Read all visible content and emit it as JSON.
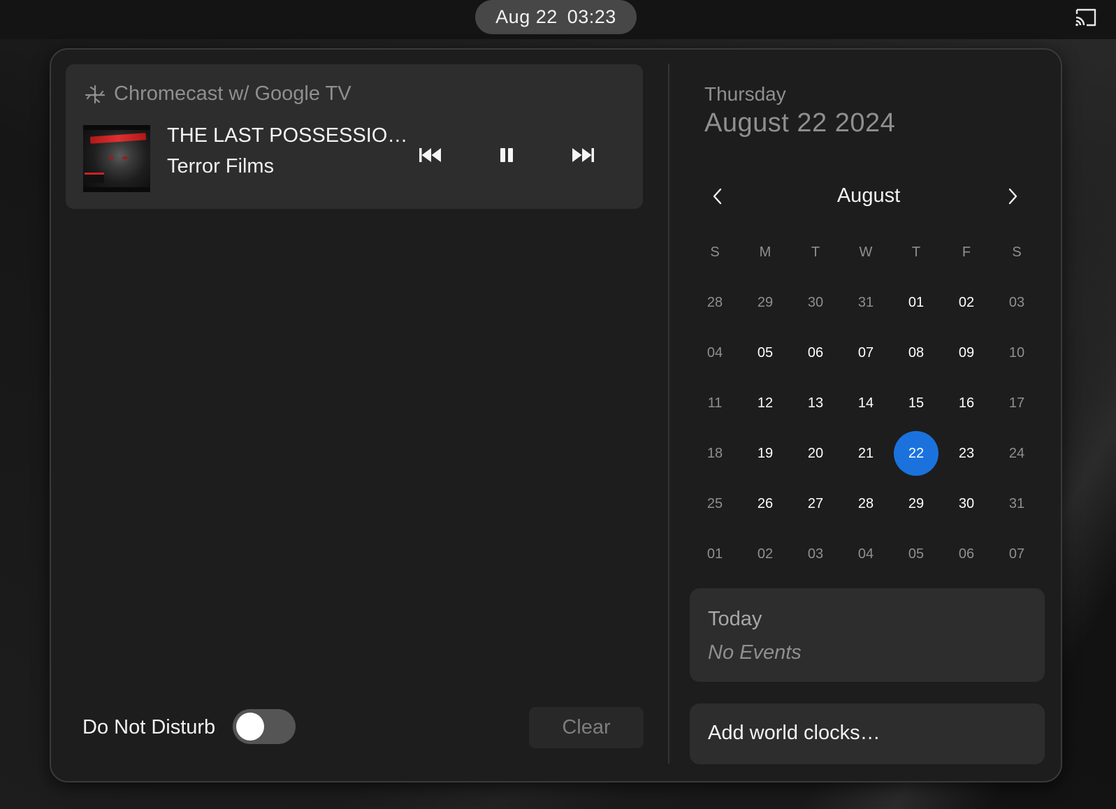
{
  "topbar": {
    "date": "Aug 22",
    "time": "03:23",
    "cast_icon": "screencast-icon"
  },
  "media": {
    "source_icon": "chromecast-device-icon",
    "source_name": "Chromecast w/ Google TV",
    "track_title": "THE LAST POSSESSIO…",
    "track_artist": "Terror Films",
    "controls": [
      "previous-track-icon",
      "pause-icon",
      "next-track-icon"
    ]
  },
  "notifications": {
    "dnd_label": "Do Not Disturb",
    "dnd_enabled": false,
    "clear_label": "Clear"
  },
  "calendar": {
    "weekday": "Thursday",
    "full_date": "August 22 2024",
    "month": "August",
    "weekdays": [
      "S",
      "M",
      "T",
      "W",
      "T",
      "F",
      "S"
    ],
    "weeks": [
      [
        {
          "d": "28",
          "dim": true
        },
        {
          "d": "29",
          "dim": true
        },
        {
          "d": "30",
          "dim": true
        },
        {
          "d": "31",
          "dim": true
        },
        {
          "d": "01"
        },
        {
          "d": "02"
        },
        {
          "d": "03",
          "dim": true
        }
      ],
      [
        {
          "d": "04",
          "dim": true
        },
        {
          "d": "05"
        },
        {
          "d": "06"
        },
        {
          "d": "07"
        },
        {
          "d": "08"
        },
        {
          "d": "09"
        },
        {
          "d": "10",
          "dim": true
        }
      ],
      [
        {
          "d": "11",
          "dim": true
        },
        {
          "d": "12"
        },
        {
          "d": "13"
        },
        {
          "d": "14"
        },
        {
          "d": "15"
        },
        {
          "d": "16"
        },
        {
          "d": "17",
          "dim": true
        }
      ],
      [
        {
          "d": "18",
          "dim": true
        },
        {
          "d": "19"
        },
        {
          "d": "20"
        },
        {
          "d": "21"
        },
        {
          "d": "22",
          "today": true
        },
        {
          "d": "23"
        },
        {
          "d": "24",
          "dim": true
        }
      ],
      [
        {
          "d": "25",
          "dim": true
        },
        {
          "d": "26"
        },
        {
          "d": "27"
        },
        {
          "d": "28"
        },
        {
          "d": "29"
        },
        {
          "d": "30"
        },
        {
          "d": "31",
          "dim": true
        }
      ],
      [
        {
          "d": "01",
          "dim": true
        },
        {
          "d": "02",
          "dim": true
        },
        {
          "d": "03",
          "dim": true
        },
        {
          "d": "04",
          "dim": true
        },
        {
          "d": "05",
          "dim": true
        },
        {
          "d": "06",
          "dim": true
        },
        {
          "d": "07",
          "dim": true
        }
      ]
    ],
    "today_color": "#1b72dd"
  },
  "events": {
    "title": "Today",
    "empty_text": "No Events"
  },
  "world_clocks": {
    "label": "Add world clocks…"
  }
}
